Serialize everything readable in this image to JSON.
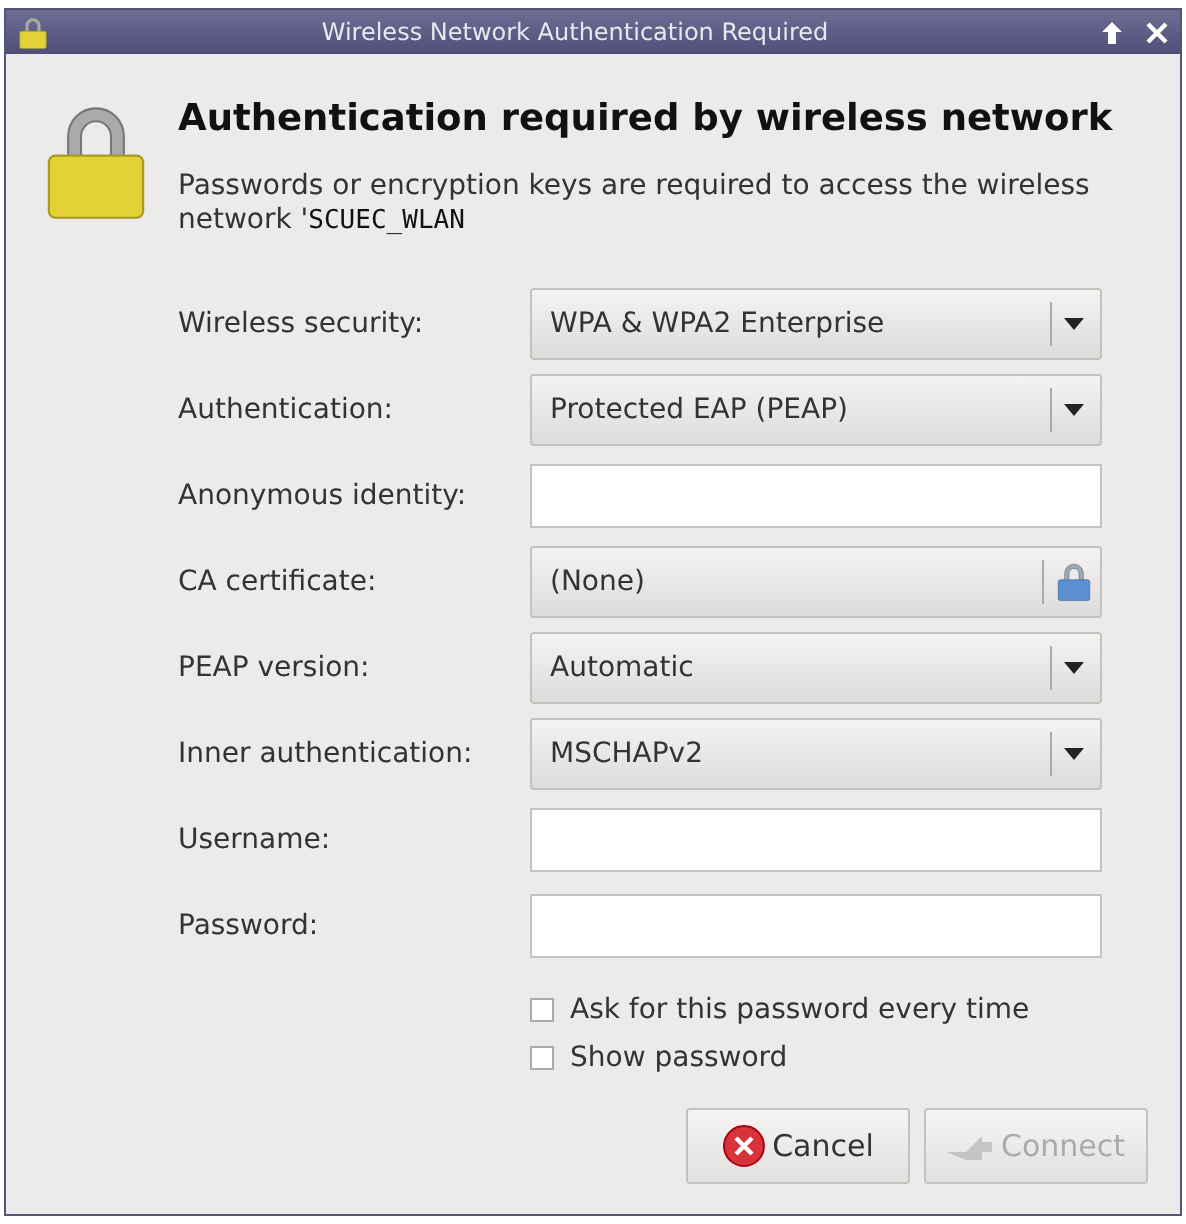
{
  "window": {
    "title": "Wireless Network Authentication Required"
  },
  "heading": "Authentication required by wireless network",
  "description": "Passwords or encryption keys are required to access the wireless network '",
  "network_name": "SCUEC_WLAN",
  "fields": [
    {
      "kind": "combo",
      "label": "Wireless security:",
      "value": "WPA & WPA2 Enterprise"
    },
    {
      "kind": "combo",
      "label": "Authentication:",
      "value": "Protected EAP (PEAP)"
    },
    {
      "kind": "entry",
      "label": "Anonymous identity:"
    },
    {
      "kind": "file",
      "label": "CA certificate:",
      "value": "(None)"
    },
    {
      "kind": "combo",
      "label": "PEAP version:",
      "value": "Automatic"
    },
    {
      "kind": "combo",
      "label": "Inner authentication:",
      "value": "MSCHAPv2"
    },
    {
      "kind": "entry",
      "label": "Username:"
    },
    {
      "kind": "entry",
      "label": "Password:"
    }
  ],
  "options": [
    {
      "label": "Ask for this password every time",
      "checked": false
    },
    {
      "label": "Show password",
      "checked": false
    }
  ],
  "buttons": [
    {
      "kind": "cancel",
      "label": "Cancel",
      "disabled": false
    },
    {
      "kind": "connect",
      "label": "Connect",
      "disabled": true
    }
  ]
}
